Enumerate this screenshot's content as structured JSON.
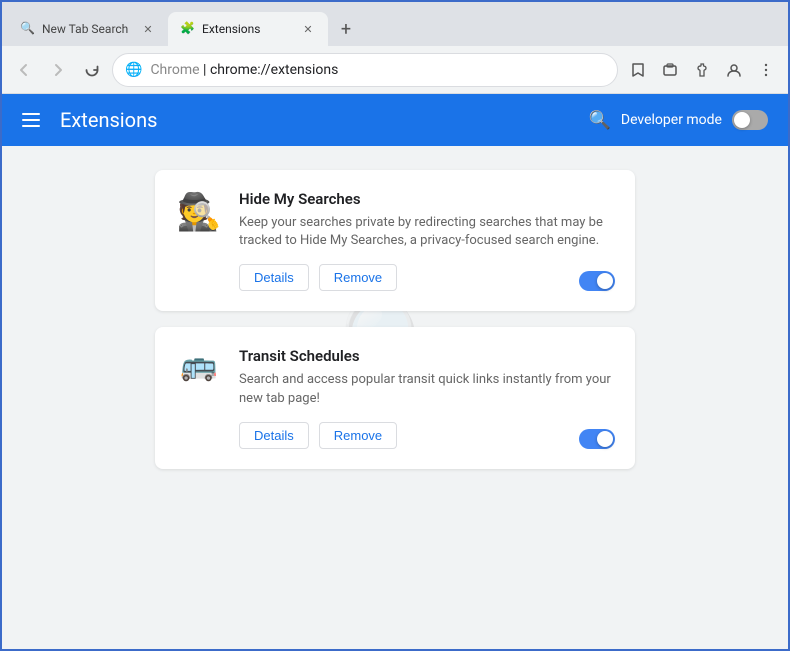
{
  "browser": {
    "tabs": [
      {
        "id": "tab-1",
        "title": "New Tab Search",
        "icon": "🔍",
        "active": false,
        "closeable": true
      },
      {
        "id": "tab-2",
        "title": "Extensions",
        "icon": "🧩",
        "active": true,
        "closeable": true
      }
    ],
    "new_tab_icon": "+",
    "nav": {
      "back_disabled": true,
      "forward_disabled": true,
      "address": {
        "chrome_label": "Chrome",
        "separator": "|",
        "url": "chrome://extensions"
      }
    }
  },
  "extensions_page": {
    "header": {
      "title": "Extensions",
      "menu_icon": "☰",
      "developer_mode_label": "Developer mode",
      "developer_mode_enabled": false
    },
    "extensions": [
      {
        "id": "ext-1",
        "name": "Hide My Searches",
        "description": "Keep your searches private by redirecting searches that may be tracked to Hide My Searches, a privacy-focused search engine.",
        "enabled": true,
        "details_label": "Details",
        "remove_label": "Remove"
      },
      {
        "id": "ext-2",
        "name": "Transit Schedules",
        "description": "Search and access popular transit quick links instantly from your new tab page!",
        "enabled": true,
        "details_label": "Details",
        "remove_label": "Remove"
      }
    ]
  }
}
